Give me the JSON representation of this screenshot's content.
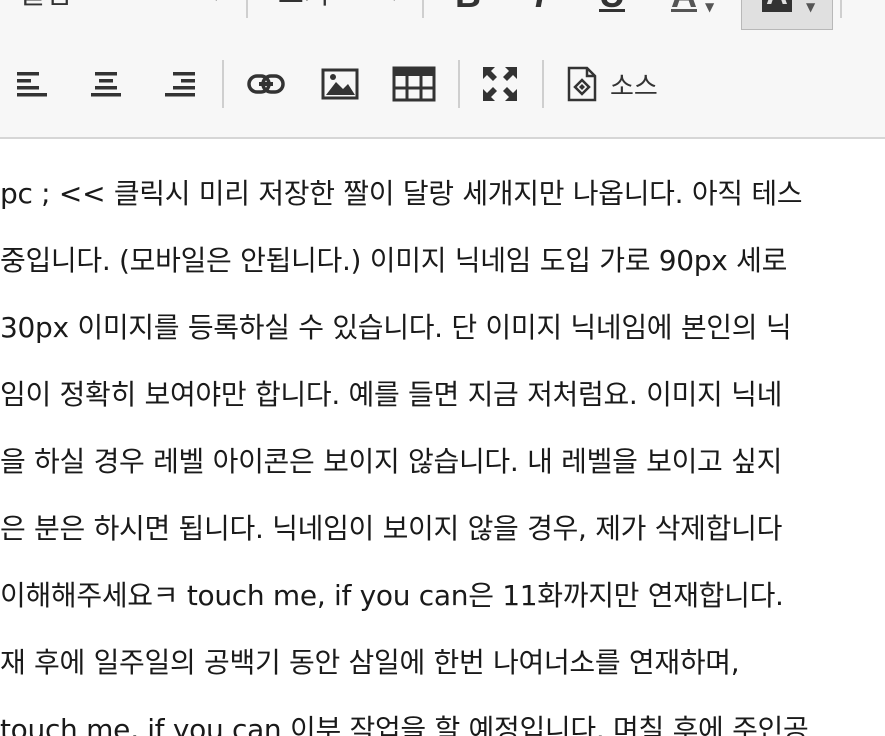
{
  "toolbar": {
    "font_combo": "굴림",
    "size_combo": "크기",
    "bold": "B",
    "italic": "I",
    "underline": "U",
    "font_color": "A",
    "bg_color": "A",
    "source_label": "소스"
  },
  "content": {
    "lines": [
      "pc ; << 클릭시 미리 저장한 짤이 달랑 세개지만 나옵니다. 아직 테스",
      "중입니다. (모바일은 안됩니다.) 이미지 닉네임 도입 가로 90px 세로",
      "30px 이미지를 등록하실 수 있습니다. 단 이미지 닉네임에 본인의 닉",
      "임이 정확히 보여야만 합니다. 예를 들면 지금 저처럼요. 이미지 닉네",
      "을 하실 경우 레벨 아이콘은 보이지 않습니다. 내 레벨을 보이고 싶지",
      "은 분은 하시면 됩니다. 닉네임이 보이지 않을 경우, 제가 삭제합니다",
      "이해해주세요ㅋ touch me, if you can은 11화까지만 연재합니다.",
      "재 후에 일주일의 공백기 동안 삼일에 한번 나여너소를 연재하며,",
      "touch me, if you can 이부 작업을 할 예정입니다. 며칠 후에 주인공"
    ]
  }
}
